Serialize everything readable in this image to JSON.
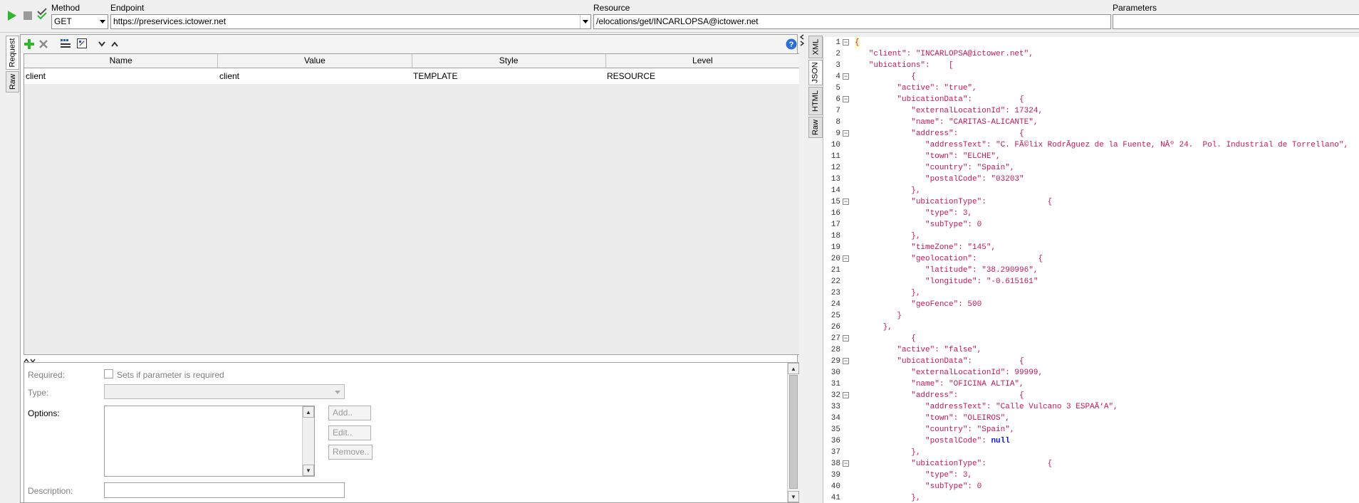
{
  "toolbar": {
    "method_label": "Method",
    "method_value": "GET",
    "endpoint_label": "Endpoint",
    "endpoint_value": "https://preservices.ictower.net",
    "resource_label": "Resource",
    "resource_value": "/elocations/get/INCARLOPSA@ictower.net",
    "parameters_label": "Parameters",
    "parameters_value": ""
  },
  "left_tabs": [
    "Request",
    "Raw"
  ],
  "grid": {
    "columns": [
      "Name",
      "Value",
      "Style",
      "Level"
    ],
    "rows": [
      [
        "client",
        "client",
        "TEMPLATE",
        "RESOURCE"
      ]
    ]
  },
  "props": {
    "required_label": "Required:",
    "required_checkbox_label": "Sets if parameter is required",
    "type_label": "Type:",
    "options_label": "Options:",
    "add_label": "Add..",
    "edit_label": "Edit..",
    "remove_label": "Remove..",
    "description_label": "Description:"
  },
  "right_tabs": [
    "XML",
    "JSON",
    "HTML",
    "Raw"
  ],
  "code": {
    "lines": [
      "{",
      "   \"client\": \"INCARLOPSA@ictower.net\",",
      "   \"ubications\":    [",
      "            {",
      "         \"active\": \"true\",",
      "         \"ubicationData\":          {",
      "            \"externalLocationId\": 17324,",
      "            \"name\": \"CARITAS-ALICANTE\",",
      "            \"address\":             {",
      "               \"addressText\": \"C. FÃ©lix RodrÃ­guez de la Fuente, NÂº 24.  Pol. Industrial de Torrellano\",",
      "               \"town\": \"ELCHE\",",
      "               \"country\": \"Spain\",",
      "               \"postalCode\": \"03203\"",
      "            },",
      "            \"ubicationType\":             {",
      "               \"type\": 3,",
      "               \"subType\": 0",
      "            },",
      "            \"timeZone\": \"145\",",
      "            \"geolocation\":             {",
      "               \"latitude\": \"38.290996\",",
      "               \"longitude\": \"-0.615161\"",
      "            },",
      "            \"geoFence\": 500",
      "         }",
      "      },",
      "            {",
      "         \"active\": \"false\",",
      "         \"ubicationData\":          {",
      "            \"externalLocationId\": 99999,",
      "            \"name\": \"OFICINA ALTIA\",",
      "            \"address\":             {",
      "               \"addressText\": \"Calle Vulcano 3 ESPAÃ‘A\",",
      "               \"town\": \"OLEIROS\",",
      "               \"country\": \"Spain\",",
      "               \"postalCode\": null",
      "            },",
      "            \"ubicationType\":             {",
      "               \"type\": 3,",
      "               \"subType\": 0",
      "            },"
    ],
    "fold_lines": [
      1,
      4,
      6,
      9,
      15,
      20,
      27,
      29,
      32,
      38
    ]
  }
}
